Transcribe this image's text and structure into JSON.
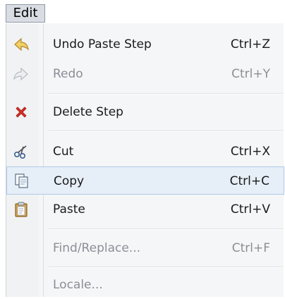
{
  "menubar": {
    "edit_label": "Edit"
  },
  "menu": {
    "items": [
      {
        "label": "Undo Paste Step",
        "shortcut": "Ctrl+Z",
        "icon": "undo-icon",
        "enabled": true
      },
      {
        "label": "Redo",
        "shortcut": "Ctrl+Y",
        "icon": "redo-icon",
        "enabled": false
      },
      {
        "label": "Delete Step",
        "shortcut": "",
        "icon": "delete-icon",
        "enabled": true
      },
      {
        "label": "Cut",
        "shortcut": "Ctrl+X",
        "icon": "cut-icon",
        "enabled": true
      },
      {
        "label": "Copy",
        "shortcut": "Ctrl+C",
        "icon": "copy-icon",
        "enabled": true,
        "highlighted": true
      },
      {
        "label": "Paste",
        "shortcut": "Ctrl+V",
        "icon": "paste-icon",
        "enabled": true
      },
      {
        "label": "Find/Replace...",
        "shortcut": "Ctrl+F",
        "icon": "",
        "enabled": false
      },
      {
        "label": "Locale...",
        "shortcut": "",
        "icon": "",
        "enabled": false
      }
    ]
  },
  "colors": {
    "highlight_bg": "#e6eef7",
    "highlight_border": "#aecbe8",
    "disabled_text": "#8a8f96",
    "delete_red": "#d93025"
  }
}
